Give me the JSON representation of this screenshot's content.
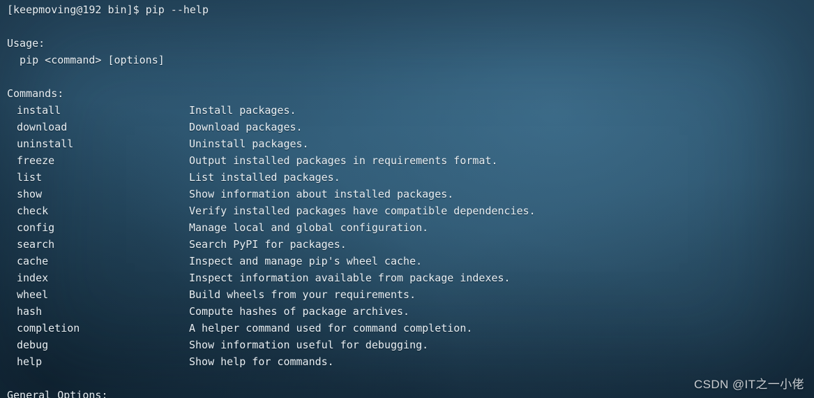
{
  "terminal": {
    "prompt_line": "[keepmoving@192 bin]$ pip --help",
    "usage_heading": "Usage:",
    "usage_line": "  pip <command> [options]",
    "commands_heading": "Commands:",
    "general_options_heading": "General Options:",
    "commands": [
      {
        "name": "install",
        "description": "Install packages."
      },
      {
        "name": "download",
        "description": "Download packages."
      },
      {
        "name": "uninstall",
        "description": "Uninstall packages."
      },
      {
        "name": "freeze",
        "description": "Output installed packages in requirements format."
      },
      {
        "name": "list",
        "description": "List installed packages."
      },
      {
        "name": "show",
        "description": "Show information about installed packages."
      },
      {
        "name": "check",
        "description": "Verify installed packages have compatible dependencies."
      },
      {
        "name": "config",
        "description": "Manage local and global configuration."
      },
      {
        "name": "search",
        "description": "Search PyPI for packages."
      },
      {
        "name": "cache",
        "description": "Inspect and manage pip's wheel cache."
      },
      {
        "name": "index",
        "description": "Inspect information available from package indexes."
      },
      {
        "name": "wheel",
        "description": "Build wheels from your requirements."
      },
      {
        "name": "hash",
        "description": "Compute hashes of package archives."
      },
      {
        "name": "completion",
        "description": "A helper command used for command completion."
      },
      {
        "name": "debug",
        "description": "Show information useful for debugging."
      },
      {
        "name": "help",
        "description": "Show help for commands."
      }
    ]
  },
  "watermark": {
    "text": "CSDN @IT之一小佬"
  },
  "colors": {
    "background_light": "#30596f",
    "background_dark": "#1c3748",
    "text": "#e9eff3",
    "watermark": "#c9cdd1"
  }
}
